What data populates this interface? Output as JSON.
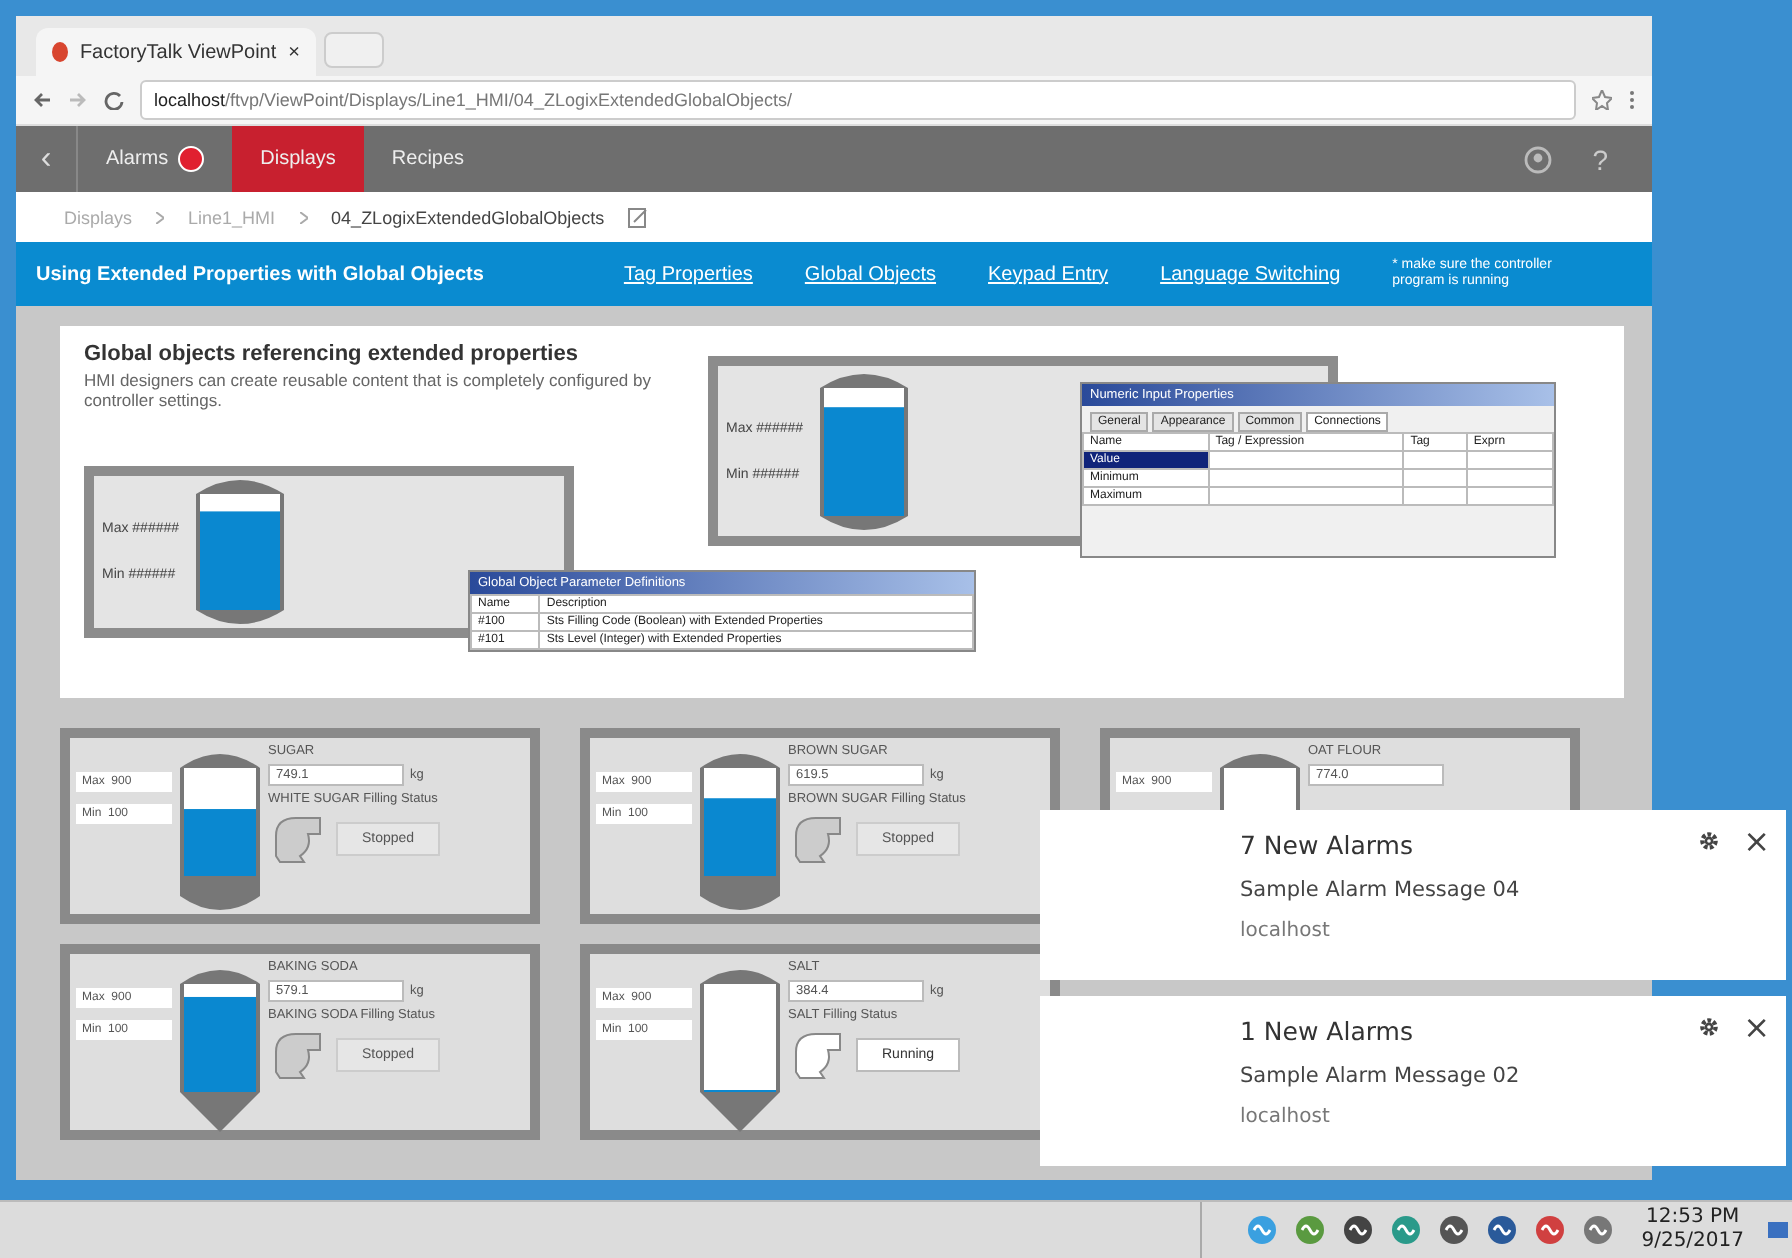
{
  "browser": {
    "tab_title": "FactoryTalk ViewPoint",
    "tab_close": "×",
    "url_host": "localhost",
    "url_path": "/ftvp/ViewPoint/Displays/Line1_HMI/04_ZLogixExtendedGlobalObjects/"
  },
  "nav": {
    "back": "‹",
    "items": [
      {
        "label": "Alarms",
        "badge": true,
        "selected": false
      },
      {
        "label": "Displays",
        "badge": false,
        "selected": true
      },
      {
        "label": "Recipes",
        "badge": false,
        "selected": false
      }
    ],
    "help": "?"
  },
  "breadcrumb": [
    "Displays",
    "Line1_HMI",
    "04_ZLogixExtendedGlobalObjects"
  ],
  "title_bar": {
    "title": "Using Extended Properties with Global Objects",
    "links": [
      "Tag Properties",
      "Global Objects",
      "Keypad Entry",
      "Language Switching"
    ],
    "note": "* make sure the controller program is running"
  },
  "intro": {
    "heading": "Global objects referencing extended properties",
    "text": "HMI designers can create reusable content that is completely configured by controller settings.",
    "previews": [
      {
        "max_label": "Max ######",
        "min_label": "Min ######"
      },
      {
        "max_label": "Max ######",
        "min_label": "Min ######"
      }
    ]
  },
  "param_dialog": {
    "title": "Global Object Parameter Definitions",
    "columns": [
      "Name",
      "Description"
    ],
    "rows": [
      [
        "#100",
        "Sts Filling Code (Boolean) with Extended Properties"
      ],
      [
        "#101",
        "Sts Level (Integer) with Extended Properties"
      ]
    ]
  },
  "props_dialog": {
    "title": "Numeric Input Properties",
    "tabs": [
      {
        "label": "General",
        "selected": false
      },
      {
        "label": "Appearance",
        "selected": false
      },
      {
        "label": "Common",
        "selected": false
      },
      {
        "label": "Connections",
        "selected": true
      }
    ],
    "columns": [
      "Name",
      "Tag / Expression",
      "Tag",
      "Exprn"
    ],
    "rows": [
      {
        "name": "Value",
        "selected": true
      },
      {
        "name": "Minimum",
        "selected": false
      },
      {
        "name": "Maximum",
        "selected": false
      }
    ]
  },
  "tanks": [
    {
      "name": "SUGAR",
      "max": "Max  900",
      "min": "Min  100",
      "value": "749.1",
      "unit": "kg",
      "status_label": "WHITE SUGAR Filling Status",
      "status": "Stopped",
      "running": false,
      "level": 0.62
    },
    {
      "name": "BROWN SUGAR",
      "max": "Max  900",
      "min": "Min  100",
      "value": "619.5",
      "unit": "kg",
      "status_label": "BROWN SUGAR Filling Status",
      "status": "Stopped",
      "running": false,
      "level": 0.72
    },
    {
      "name": "OAT FLOUR",
      "max": "Max  900",
      "value": "774.0"
    },
    {
      "name": "BAKING SODA",
      "max": "Max  900",
      "min": "Min  100",
      "value": "579.1",
      "unit": "kg",
      "status_label": "BAKING SODA Filling Status",
      "status": "Stopped",
      "running": false,
      "level": 0.88
    },
    {
      "name": "SALT",
      "max": "Max  900",
      "min": "Min  100",
      "value": "384.4",
      "unit": "kg",
      "status_label": "SALT Filling Status",
      "status": "Running",
      "running": true,
      "level": 0
    }
  ],
  "notifications": [
    {
      "title": "7 New Alarms",
      "message": "Sample Alarm Message 04",
      "source": "localhost",
      "close": "×"
    },
    {
      "title": "1 New Alarms",
      "message": "Sample Alarm Message 02",
      "source": "localhost",
      "close": "×"
    }
  ],
  "taskbar": {
    "time": "12:53 PM",
    "date": "9/25/2017"
  }
}
